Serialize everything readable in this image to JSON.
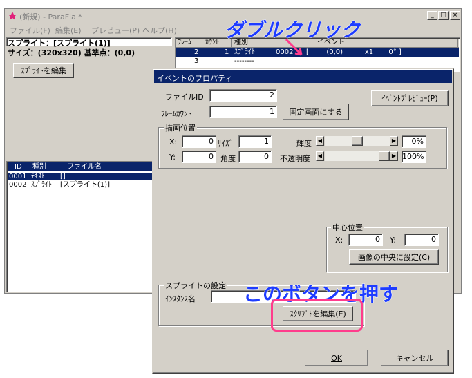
{
  "main_window": {
    "title": "(新規) - ParaFla *",
    "menu": [
      "ファイル(F)",
      "編集(E)",
      "プレビュー(P)",
      "ヘルプ(H)"
    ],
    "sprite_line": "スプライト：[スプライト(1)]",
    "size_line": "サイズ：(320x320)  基準点：(0,0)",
    "edit_sprite_button": "ｽﾌﾟﾗｲﾄを編集",
    "list_headers": [
      "ID",
      "種別",
      "ファイル名"
    ],
    "list_rows": [
      {
        "id": "0001",
        "type": "ﾃｷｽﾄ",
        "name": "[]"
      },
      {
        "id": "0002",
        "type": "ｽﾌﾟﾗｲﾄ",
        "name": "[スプライト(1)]"
      }
    ],
    "timeline_headers": [
      "ﾌﾚｰﾑ",
      "ｶｳﾝﾄ",
      "種別",
      "イベント"
    ],
    "timeline_rows": [
      {
        "frame": "2",
        "count": "1",
        "type": "ｽﾌﾟﾗｲﾄ",
        "id": "0002",
        "event": "[        (0,0)          x1       0° ]"
      },
      {
        "frame": "3",
        "count": "",
        "type": "--------",
        "id": "",
        "event": ""
      }
    ]
  },
  "dialog": {
    "title": "イベントのプロパティ",
    "file_id_label": "ファイルID",
    "file_id_value": "2",
    "frame_count_label": "ﾌﾚｰﾑｶｳﾝﾄ",
    "frame_count_value": "1",
    "fixed_screen_button": "固定画面にする",
    "event_preview_button": "ｲﾍﾞﾝﾄﾌﾟﾚﾋﾞｭｰ(P)",
    "draw_position": {
      "group_label": "描画位置",
      "x_label": "X:",
      "x_value": "0",
      "size_label": "ｻｲｽﾞ",
      "size_value": "1",
      "brightness_label": "輝度",
      "brightness_value": "0%",
      "brightness_level": 0.5,
      "y_label": "Y:",
      "y_value": "0",
      "angle_label": "角度",
      "angle_value": "0",
      "opacity_label": "不透明度",
      "opacity_value": "100%",
      "opacity_level": 1.0
    },
    "center_position": {
      "group_label": "中心位置",
      "x_label": "X:",
      "x_value": "0",
      "y_label": "Y:",
      "y_value": "0",
      "center_button": "画像の中央に設定(C)"
    },
    "sprite_settings": {
      "group_label": "スプライトの設定",
      "instance_label": "ｲﾝｽﾀﾝｽ名",
      "instance_value": "",
      "script_button": "ｽｸﾘﾌﾟﾄを編集(E)"
    },
    "ok_button": "OK",
    "cancel_button": "キャンセル"
  },
  "annotations": {
    "double_click": "ダブルクリック",
    "press_button": "このボタンを押す",
    "arrow_color": "#ff3c8c",
    "highlight_color": "#ff3c8c",
    "text_color": "#1e3cff"
  },
  "colors": {
    "selection": "#0a246a",
    "window_bg": "#d4d0c8"
  }
}
